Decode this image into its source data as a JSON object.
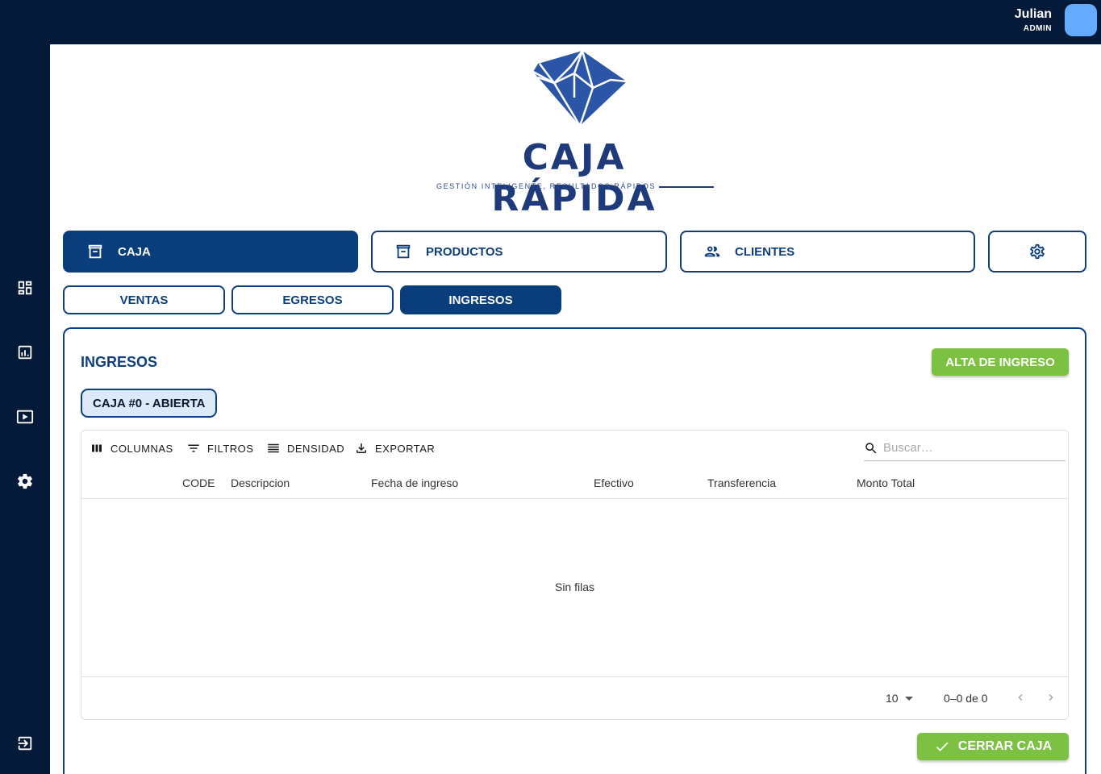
{
  "user": {
    "name": "Julian",
    "role": "ADMIN"
  },
  "sidebar": {
    "items": [
      {
        "icon": "dashboard-icon"
      },
      {
        "icon": "report-icon"
      },
      {
        "icon": "video-icon"
      },
      {
        "icon": "settings-icon"
      },
      {
        "icon": "logout-icon"
      }
    ]
  },
  "logo": {
    "title": "CAJA RÁPIDA",
    "tagline": "GESTIÓN INTELIGENTE, RESULTADOS RÁPIDOS"
  },
  "nav": {
    "caja": "CAJA",
    "productos": "PRODUCTOS",
    "clientes": "CLIENTES",
    "active": "CAJA"
  },
  "subnav": {
    "ventas": "VENTAS",
    "egresos": "EGRESOS",
    "ingresos": "INGRESOS",
    "active": "INGRESOS"
  },
  "panel": {
    "title": "INGRESOS",
    "alta_button": "ALTA DE INGRESO",
    "chip": "CAJA #0 - ABIERTA",
    "cerrar_button": "CERRAR CAJA"
  },
  "grid": {
    "toolbar": {
      "columnas": "COLUMNAS",
      "filtros": "FILTROS",
      "densidad": "DENSIDAD",
      "exportar": "EXPORTAR"
    },
    "search_placeholder": "Buscar…",
    "columns": [
      "CODE",
      "Descripcion",
      "Fecha de ingreso",
      "Efectivo",
      "Transferencia",
      "Monto Total"
    ],
    "rows": [],
    "empty_text": "Sin filas",
    "page_size": "10",
    "range": "0–0 de 0"
  },
  "colors": {
    "navy": "#041a38",
    "primary": "#0a3d7c",
    "green": "#7dc142",
    "avatar": "#64aaff"
  }
}
